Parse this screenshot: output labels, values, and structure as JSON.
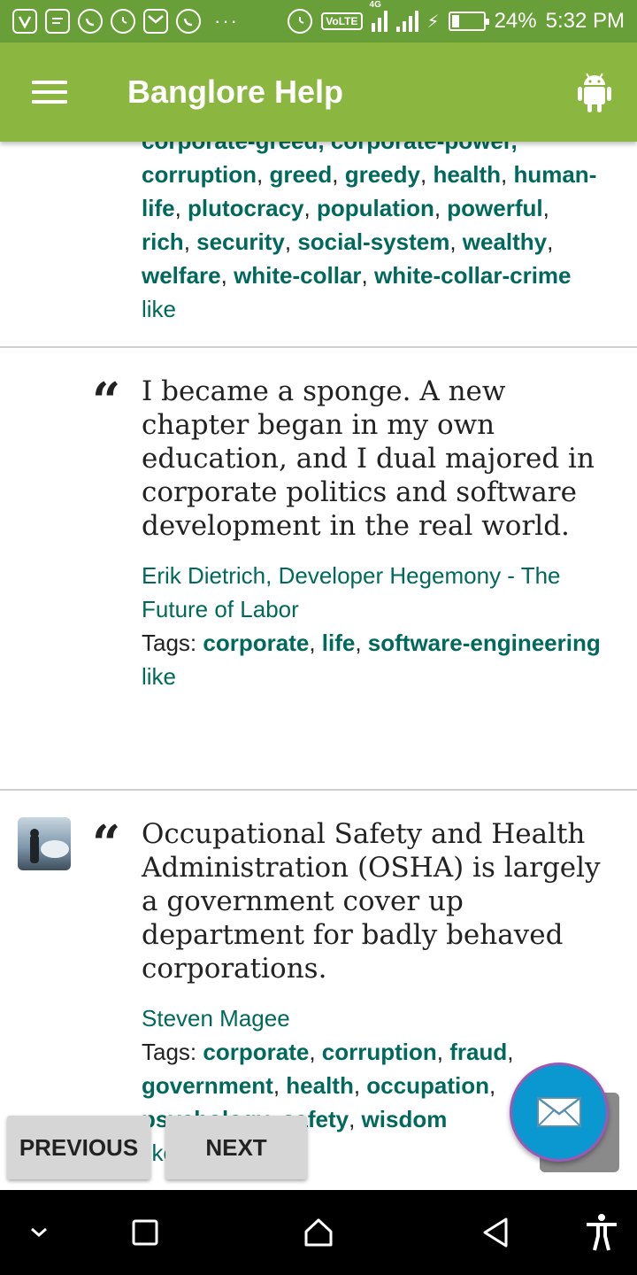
{
  "status_bar": {
    "battery_text": "24%",
    "battery_level": 0.24,
    "time": "5:32 PM",
    "network_badge": "VoLTE",
    "network_type": "4G",
    "notification_icons": [
      "app-icon",
      "message-icon",
      "whatsapp-icon",
      "alarm-icon",
      "gmail-icon",
      "whatsapp-icon"
    ],
    "overflow_dots": "···"
  },
  "toolbar": {
    "title": "Banglore Help",
    "menu_icon": "hamburger-icon",
    "action_icon": "android-icon",
    "background_color": "#8bb63f"
  },
  "quotes": [
    {
      "partial_tags_line": "corporate-greed, corporate-power,",
      "tags": [
        "corruption",
        "greed",
        "greedy",
        "health",
        "human-life",
        "plutocracy",
        "population",
        "powerful",
        "rich",
        "security",
        "social-system",
        "wealthy",
        "welfare",
        "white-collar",
        "white-collar-crime"
      ],
      "like_label": "like"
    },
    {
      "text": "I became a sponge. A new chapter began in my own education, and I dual majored in corporate politics and software development in the real world.",
      "author": "Erik Dietrich",
      "source": "Developer Hegemony - The Future of Labor",
      "tags_label": "Tags:",
      "tags": [
        "corporate",
        "life",
        "software-engineering"
      ],
      "like_label": "like"
    },
    {
      "text": "Occupational Safety and Health Administration (OSHA) is largely a government cover up department for badly behaved corporations.",
      "author": "Steven Magee",
      "tags_label": "Tags:",
      "tags": [
        "corporate",
        "corruption",
        "fraud",
        "government",
        "health",
        "occupation",
        "psychology",
        "safety",
        "wisdom"
      ],
      "like_label": "like"
    }
  ],
  "buttons": {
    "previous": "PREVIOUS",
    "next": "NEXT"
  },
  "fab": {
    "icon": "envelope-icon",
    "color": "#0b97cf"
  },
  "nav_bar": {
    "icons": [
      "chevron-down-icon",
      "recents-icon",
      "home-icon",
      "back-icon",
      "accessibility-icon"
    ]
  },
  "colors": {
    "status_bar": "#689f38",
    "link": "#00695c"
  }
}
